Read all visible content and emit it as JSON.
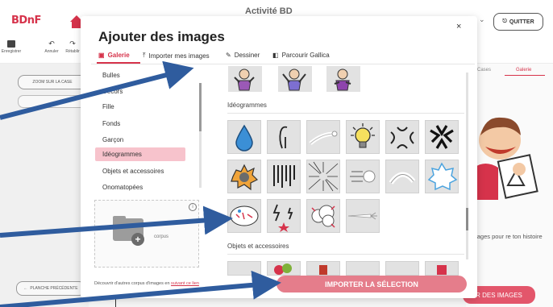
{
  "app": {
    "logo": "BDnF",
    "title": "Activité BD",
    "quit_label": "QUITTER",
    "toolbar": [
      {
        "label": "Enregistrer",
        "icon": "save-icon"
      },
      {
        "label": "Annuler",
        "icon": "undo-icon"
      },
      {
        "label": "Rétablir",
        "icon": "redo-icon"
      }
    ],
    "zoom_label": "ZOOM SUR LA CASE",
    "prev_label": "PLANCHE PRÉCÉDENTE",
    "right_tabs": [
      "Cases",
      "Galerie"
    ],
    "right_text": "s images pour re ton histoire",
    "right_button": "R DES IMAGES"
  },
  "modal": {
    "title": "Ajouter des images",
    "close": "×",
    "tabs": [
      {
        "label": "Galerie",
        "icon": "gallery-icon",
        "active": true
      },
      {
        "label": "Importer mes images",
        "icon": "upload-icon",
        "active": false
      },
      {
        "label": "Dessiner",
        "icon": "pencil-icon",
        "active": false
      },
      {
        "label": "Parcourir Gallica",
        "icon": "gallica-icon",
        "active": false
      }
    ],
    "categories": [
      "Bulles",
      "Décors",
      "Fille",
      "Fonds",
      "Garçon",
      "Idéogrammes",
      "Objets et accessoires",
      "Onomatopées"
    ],
    "active_category": "Idéogrammes",
    "corpus_label": "corpus",
    "info": "i",
    "discover_text": "Découvrir d'autres corpus d'images en",
    "discover_link": "suivant ce lien",
    "sections": [
      "Idéogrammes",
      "Objets et accessoires"
    ],
    "import_button": "IMPORTER LA SÉLECTION"
  },
  "colors": {
    "accent": "#d6334b",
    "active_category_bg": "#f7c3cc",
    "import_button": "#e57d8b",
    "arrow": "#2f5c9e"
  }
}
